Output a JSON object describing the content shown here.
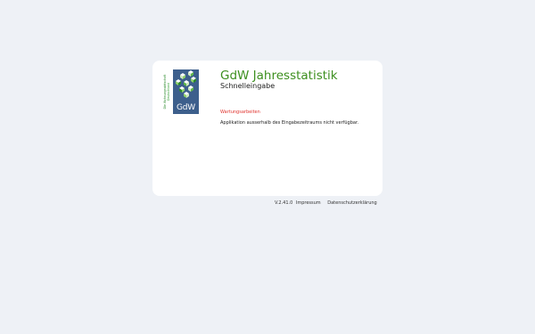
{
  "logo": {
    "vertical_line1": "Die Wohnungswirtschaft",
    "vertical_line2": "Deutschland",
    "text": "GdW",
    "colors": {
      "box": "#3d5f8c",
      "green": "#2b8a2b",
      "light_green": "#8fd16a",
      "white": "#ffffff"
    }
  },
  "header": {
    "title": "GdW Jahresstatistik",
    "subtitle": "Schnelleingabe"
  },
  "notice": {
    "title": "Wartungsarbeiten",
    "message": "Applikation ausserhalb des Eingabezeitraums nicht verfügbar."
  },
  "footer": {
    "version": "V.2.41.0",
    "impressum": "Impressum",
    "datenschutz": "Datenschutzerklärung"
  },
  "colors": {
    "page_bg": "#eef1f6",
    "card_bg": "#ffffff",
    "title_green": "#3d8f1f",
    "warning_red": "#e0322d"
  }
}
